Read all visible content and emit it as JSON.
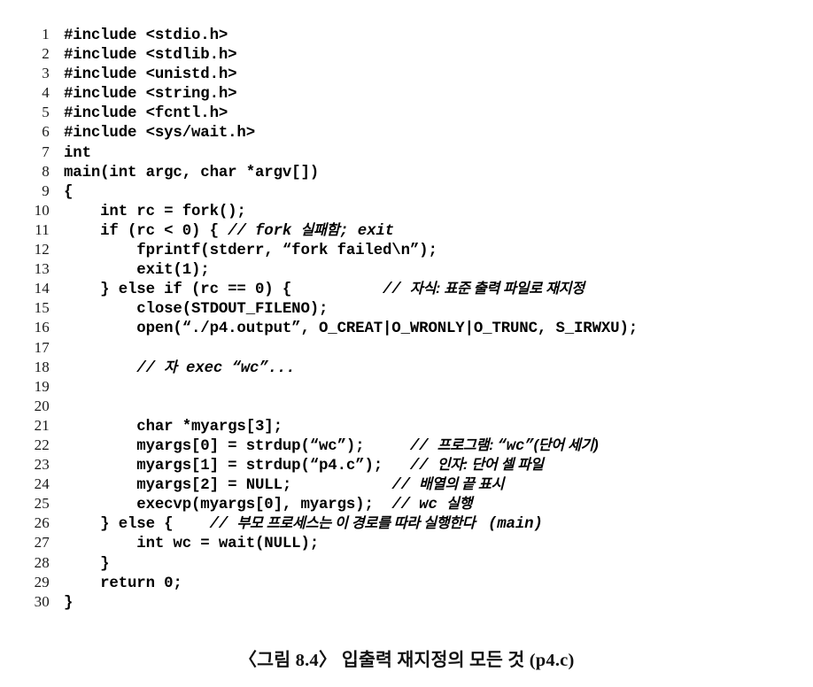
{
  "figure": {
    "caption": "〈그림 8.4〉 입출력 재지정의 모든 것 (p4.c)",
    "language": "c",
    "filename": "p4.c"
  },
  "code": {
    "first_line_number": 1,
    "last_line_number": 30,
    "lines": [
      {
        "n": "1",
        "code": "#include <stdio.h>"
      },
      {
        "n": "2",
        "code": "#include <stdlib.h>"
      },
      {
        "n": "3",
        "code": "#include <unistd.h>"
      },
      {
        "n": "4",
        "code": "#include <string.h>"
      },
      {
        "n": "5",
        "code": "#include <fcntl.h>"
      },
      {
        "n": "6",
        "code": "#include <sys/wait.h>"
      },
      {
        "n": "7",
        "code": "int"
      },
      {
        "n": "8",
        "code": "main(int argc, char *argv[])"
      },
      {
        "n": "9",
        "code": "{"
      },
      {
        "n": "10",
        "code": "    int rc = fork();"
      },
      {
        "n": "11",
        "code": "    if (rc < 0) { ",
        "comment_latin": "// fork ",
        "comment_ko": "실패함",
        "comment_latin2": "; exit"
      },
      {
        "n": "12",
        "code": "        fprintf(stderr, “fork failed\\n”);"
      },
      {
        "n": "13",
        "code": "        exit(1);"
      },
      {
        "n": "14",
        "code": "    } else if (rc == 0) {          ",
        "comment_latin": "// ",
        "comment_ko": "자식: 표준 출력 파일로 재지정"
      },
      {
        "n": "15",
        "code": "        close(STDOUT_FILENO);"
      },
      {
        "n": "16",
        "code": "        open(“./p4.output”, O_CREAT|O_WRONLY|O_TRUNC, S_IRWXU);"
      },
      {
        "n": "17",
        "code": ""
      },
      {
        "n": "18",
        "code": "        ",
        "comment_latin": "// ",
        "comment_ko": "자",
        "comment_latin2": " exec “wc”..."
      },
      {
        "n": "19",
        "code": ""
      },
      {
        "n": "20",
        "code": ""
      },
      {
        "n": "21",
        "code": "        char *myargs[3];"
      },
      {
        "n": "22",
        "code": "        myargs[0] = strdup(“wc”);     ",
        "comment_latin": "// ",
        "comment_ko": "프로그램: ",
        "comment_latin2": "“wc”",
        "comment_ko2": "(단어 세기)"
      },
      {
        "n": "23",
        "code": "        myargs[1] = strdup(“p4.c”);   ",
        "comment_latin": "// ",
        "comment_ko": "인자: 단어 셀 파일"
      },
      {
        "n": "24",
        "code": "        myargs[2] = NULL;           ",
        "comment_latin": "// ",
        "comment_ko": "배열의 끝 표시"
      },
      {
        "n": "25",
        "code": "        execvp(myargs[0], myargs);  ",
        "comment_latin": "// wc ",
        "comment_ko": "실행"
      },
      {
        "n": "26",
        "code": "    } else {    ",
        "comment_latin": "// ",
        "comment_ko": "부모 프로세스는 이 경로를 따라 실행한다 ",
        "comment_latin2": " (main)"
      },
      {
        "n": "27",
        "code": "        int wc = wait(NULL);"
      },
      {
        "n": "28",
        "code": "    }"
      },
      {
        "n": "29",
        "code": "    return 0;"
      },
      {
        "n": "30",
        "code": "}"
      }
    ]
  },
  "colors": {
    "page_background": "#ffffff",
    "text": "#000000",
    "line_number": "#1a1a1a"
  }
}
